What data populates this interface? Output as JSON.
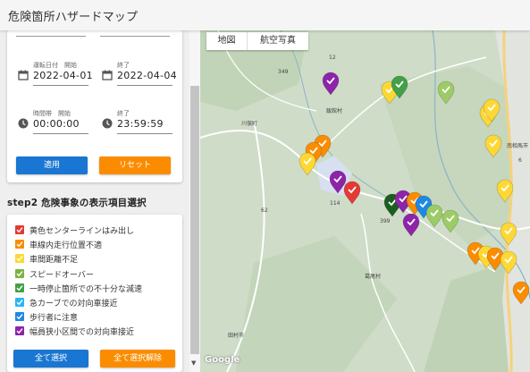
{
  "app": {
    "title": "危険箇所ハザードマップ"
  },
  "filters": {
    "start_date": {
      "label": "運転日付　開始",
      "value": "2022-04-01"
    },
    "end_date": {
      "label": "終了",
      "value": "2022-04-04"
    },
    "start_time": {
      "label": "時間帯　開始",
      "value": "00:00:00"
    },
    "end_time": {
      "label": "終了",
      "value": "23:59:59"
    },
    "apply_label": "適用",
    "reset_label": "リセット"
  },
  "step2": {
    "title": "step2 危険事象の表示項目選択",
    "items": [
      {
        "label": "黄色センターラインはみ出し",
        "color": "#e53935",
        "checked": true
      },
      {
        "label": "車線内走行位置不適",
        "color": "#fb8c00",
        "checked": true
      },
      {
        "label": "車間距離不足",
        "color": "#fdd835",
        "checked": true
      },
      {
        "label": "スピードオーバー",
        "color": "#7cb342",
        "checked": true
      },
      {
        "label": "一時停止箇所での不十分な減速",
        "color": "#43a047",
        "checked": true
      },
      {
        "label": "急カーブでの対向車接近",
        "color": "#29b6f6",
        "checked": true
      },
      {
        "label": "歩行者に注意",
        "color": "#1e88e5",
        "checked": true
      },
      {
        "label": "幅員狭小区間での対向車接近",
        "color": "#8e24aa",
        "checked": true
      }
    ],
    "select_all_label": "全て選択",
    "deselect_all_label": "全て選択解除"
  },
  "map": {
    "type_options": [
      "地図",
      "航空写真"
    ],
    "selected_type": "地図",
    "attribution": "Google",
    "place_labels": [
      "飯館村",
      "川俣町",
      "葛尾村",
      "田村市",
      "南相馬市"
    ],
    "route_labels": [
      "349",
      "399",
      "114",
      "12",
      "62",
      "6"
    ],
    "marker_colors": {
      "red": "#e53935",
      "orange": "#fb8c00",
      "yellow": "#fdd835",
      "lightgreen": "#9ccc65",
      "green": "#43a047",
      "darkgreen": "#1b5e20",
      "blue": "#1e88e5",
      "purple": "#8e24aa"
    }
  }
}
